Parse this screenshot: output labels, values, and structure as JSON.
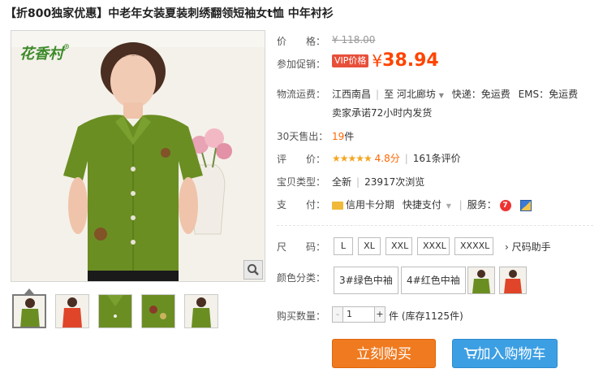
{
  "product": {
    "title": "【折800独家优惠】中老年女装夏装刺绣翻领短袖女t恤 中年衬衫",
    "brand_logo_text": "花香村",
    "brand_reg": "®"
  },
  "price": {
    "label": "价　　格：",
    "original": "¥ 118.00",
    "promo_label": "参加促销：",
    "vip_badge": "VIP价格",
    "currency": "¥",
    "current": "38.94"
  },
  "shipping": {
    "label": "物流运费：",
    "from": "江西南昌",
    "to_label": "至",
    "to": "河北廊坊",
    "express": "快递：免运费",
    "ems": "EMS：免运费",
    "promise": "卖家承诺72小时内发货"
  },
  "sales": {
    "label": "30天售出：",
    "count": "19",
    "unit": "件"
  },
  "rating": {
    "label": "评　　价：",
    "stars": "★★★★★",
    "score": "4.8分",
    "reviews": "161条评价"
  },
  "item_type": {
    "label": "宝贝类型：",
    "value": "全新",
    "views": "23917次浏览"
  },
  "payment": {
    "label": "支　　付：",
    "credit": "信用卡分期",
    "quick": "快捷支付",
    "service_label": "服务："
  },
  "size": {
    "label": "尺　　码：",
    "options": [
      "L",
      "XL",
      "XXL",
      "XXXL",
      "XXXXL"
    ],
    "guide": "尺码助手"
  },
  "color": {
    "label": "颜色分类：",
    "options": [
      "3#绿色中袖",
      "4#红色中袖"
    ],
    "swatch_colors": [
      "#6b8e23",
      "#e0452a"
    ]
  },
  "quantity": {
    "label": "购买数量：",
    "minus": "-",
    "value": "1",
    "plus": "+",
    "unit": "件",
    "stock": "(库存1125件)"
  },
  "actions": {
    "buy_now": "立刻购买",
    "add_cart": "加入购物车"
  },
  "colors": {
    "accent": "#ff4400",
    "buy_button": "#f07a1f",
    "cart_button": "#3d9fe3",
    "shirt_green": "#6b8e23"
  }
}
